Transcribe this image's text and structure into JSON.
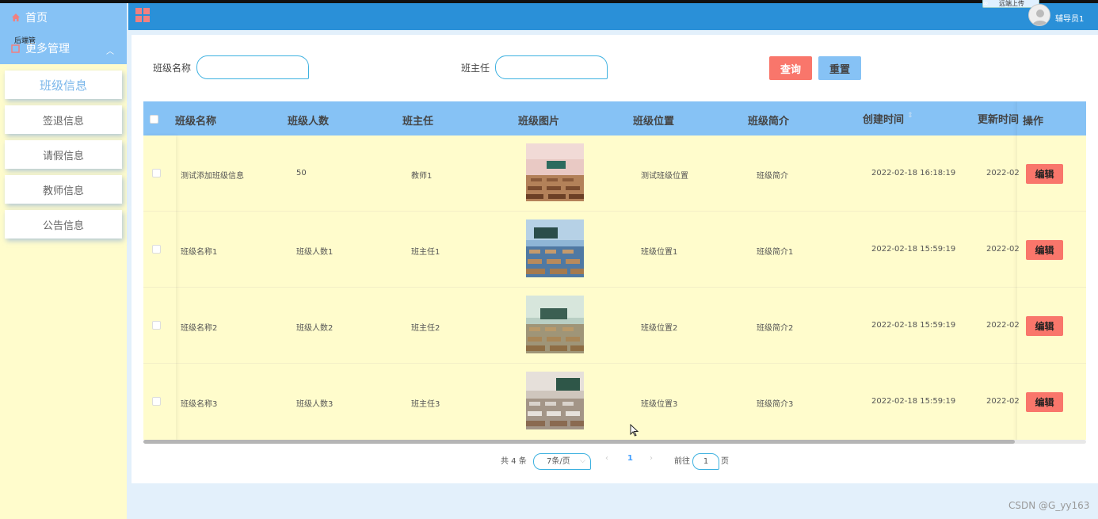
{
  "sidebar": {
    "home": "首页",
    "more": "更多管理",
    "more_tiny": "后端管",
    "items": [
      {
        "label": "班级信息"
      },
      {
        "label": "签退信息"
      },
      {
        "label": "请假信息"
      },
      {
        "label": "教师信息"
      },
      {
        "label": "公告信息"
      }
    ]
  },
  "header": {
    "upload": "远端上传",
    "user": "辅导员1"
  },
  "filters": {
    "class_name_label": "班级名称",
    "teacher_label": "班主任",
    "search_btn": "查询",
    "reset_btn": "重置"
  },
  "table": {
    "columns": [
      "班级名称",
      "班级人数",
      "班主任",
      "班级图片",
      "班级位置",
      "班级简介",
      "创建时间",
      "更新时间",
      "操作"
    ],
    "rows": [
      {
        "name": "测试添加班级信息",
        "count": "50",
        "teacher": "教师1",
        "location": "测试班级位置",
        "intro": "班级简介",
        "created": "2022-02-18 16:18:19",
        "updated": "2022-02",
        "action": "编辑"
      },
      {
        "name": "班级名称1",
        "count": "班级人数1",
        "teacher": "班主任1",
        "location": "班级位置1",
        "intro": "班级简介1",
        "created": "2022-02-18 15:59:19",
        "updated": "2022-02",
        "action": "编辑"
      },
      {
        "name": "班级名称2",
        "count": "班级人数2",
        "teacher": "班主任2",
        "location": "班级位置2",
        "intro": "班级简介2",
        "created": "2022-02-18 15:59:19",
        "updated": "2022-02",
        "action": "编辑"
      },
      {
        "name": "班级名称3",
        "count": "班级人数3",
        "teacher": "班主任3",
        "location": "班级位置3",
        "intro": "班级简介3",
        "created": "2022-02-18 15:59:19",
        "updated": "2022-02",
        "action": "编辑"
      }
    ]
  },
  "pager": {
    "total": "共 4 条",
    "page_size": "7条/页",
    "current": "1",
    "goto_prefix": "前往",
    "goto_value": "1",
    "goto_suffix": "页"
  },
  "watermark": "CSDN @G_yy163"
}
